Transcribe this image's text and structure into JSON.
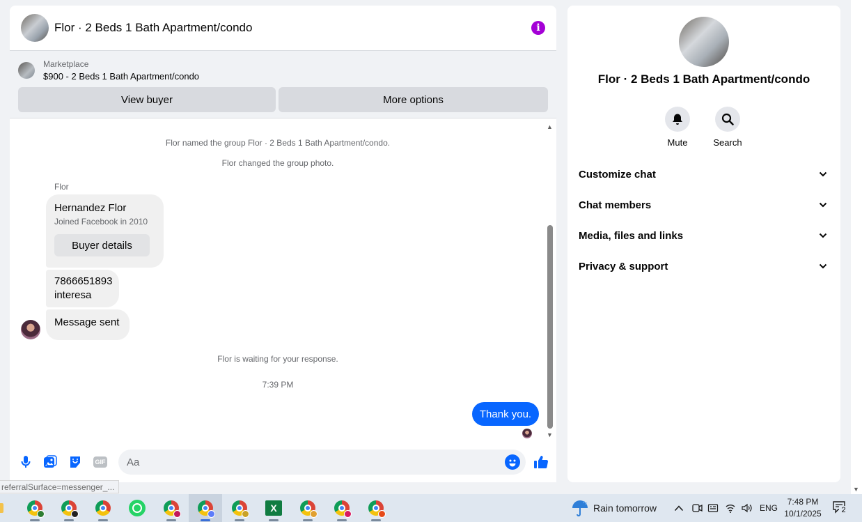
{
  "chat": {
    "title": "Flor · 2 Beds 1 Bath Apartment/condo",
    "marketplace_label": "Marketplace",
    "listing": "$900 - 2 Beds 1 Bath Apartment/condo",
    "view_buyer": "View buyer",
    "more_options": "More options",
    "system_named": "Flor named the group Flor · 2 Beds 1 Bath Apartment/condo.",
    "system_photo": "Flor changed the group photo.",
    "sender": "Flor",
    "card_name": "Hernandez Flor",
    "card_joined": "Joined Facebook in 2010",
    "buyer_details": "Buyer details",
    "phone": "7866651893",
    "interesa": "interesa",
    "message_sent": "Message sent",
    "waiting": "Flor is waiting for your response.",
    "time": "7:39 PM",
    "outgoing": "Thank you.",
    "input_placeholder": "Aa"
  },
  "status_url": "referralSurface=messenger_...",
  "details": {
    "title": "Flor · 2 Beds 1 Bath Apartment/condo",
    "mute": "Mute",
    "search": "Search",
    "sections": [
      "Customize chat",
      "Chat members",
      "Media, files and links",
      "Privacy & support"
    ]
  },
  "taskbar": {
    "weather": "Rain tomorrow",
    "lang": "ENG",
    "time": "7:48 PM",
    "date": "10/1/2025",
    "notifications": "2"
  },
  "colors": {
    "accent": "#0866ff",
    "info": "#a400d6"
  }
}
